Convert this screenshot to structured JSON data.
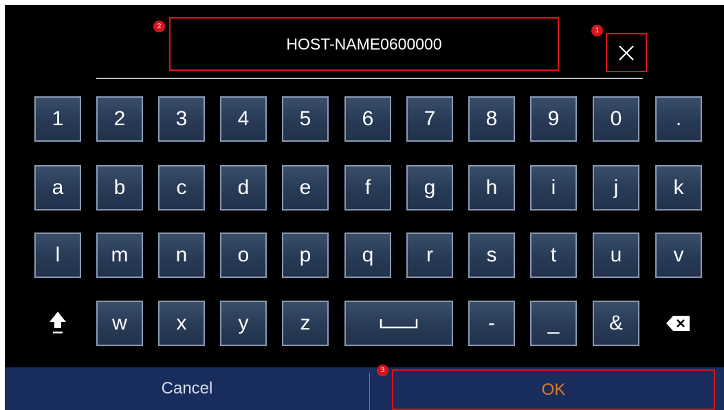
{
  "input": {
    "value": "HOST-NAME0600000"
  },
  "markers": {
    "clear": "1",
    "input": "2",
    "ok": "3"
  },
  "keys": {
    "row1": [
      "1",
      "2",
      "3",
      "4",
      "5",
      "6",
      "7",
      "8",
      "9",
      "0",
      "."
    ],
    "row2": [
      "a",
      "b",
      "c",
      "d",
      "e",
      "f",
      "g",
      "h",
      "i",
      "j",
      "k"
    ],
    "row3": [
      "l",
      "m",
      "n",
      "o",
      "p",
      "q",
      "r",
      "s",
      "t",
      "u",
      "v"
    ],
    "row4": [
      "w",
      "x",
      "y",
      "z",
      "-",
      "_",
      "&"
    ]
  },
  "icons": {
    "clear": "close-icon",
    "shift": "shift-icon",
    "space": "space-icon",
    "backspace": "backspace-icon"
  },
  "buttons": {
    "cancel_label": "Cancel",
    "ok_label": "OK"
  },
  "colors": {
    "screen_bg": "#000000",
    "key_fill": "#283a55",
    "key_border": "#8a99b2",
    "highlight": "#d9131d",
    "bar_bg": "#192d5c",
    "ok_text": "#e07a2a"
  }
}
